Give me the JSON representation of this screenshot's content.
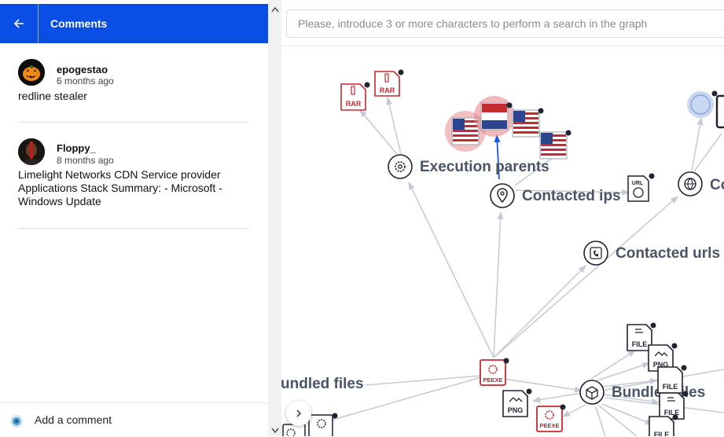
{
  "sidebar": {
    "title": "Comments",
    "comments": [
      {
        "author": "epogestao",
        "time": "6 months ago",
        "text": "redline stealer"
      },
      {
        "author": "Floppy_",
        "time": "8 months ago",
        "text": "Limelight Networks CDN Service provider Applications Stack Summary: - Microsoft - Windows Update"
      }
    ],
    "add_comment_label": "Add a comment"
  },
  "search": {
    "placeholder": "Please, introduce 3 or more characters to perform a search in the graph"
  },
  "graph": {
    "labels": {
      "execution_parents": "Execution parents",
      "contacted_ips": "Contacted ips",
      "contacted_urls": "Contacted urls",
      "contacted_domains_partial": "Co",
      "bundled_files_left": "undled files",
      "bundled_files_right": "Bundled files"
    },
    "file_badges": {
      "rar": "RAR",
      "peexe": "PEEXE",
      "file": "FILE",
      "png": "PNG",
      "url": "URL"
    },
    "colors": {
      "edge": "#c4c9d4",
      "node_stroke": "#1f2430",
      "red_file": "#c8282e",
      "highlight": "#e88a8f",
      "highlight_edge": "#1557e0",
      "header_blue": "#0b4ee6"
    }
  }
}
